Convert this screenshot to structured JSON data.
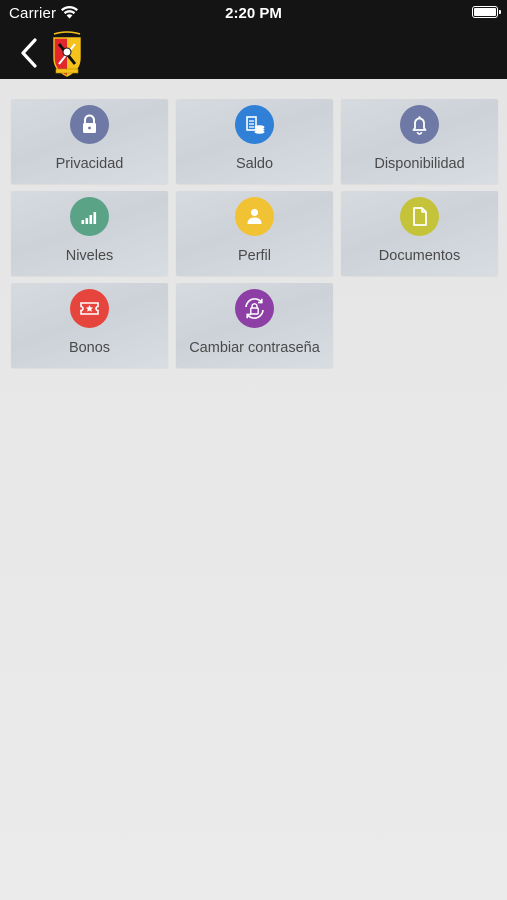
{
  "status_bar": {
    "carrier": "Carrier",
    "time": "2:20 PM"
  },
  "navbar": {
    "back_icon": "chevron-left-icon",
    "logo_icon": "club-crest-icon"
  },
  "menu": {
    "items": [
      {
        "label": "Privacidad",
        "icon": "lock-icon",
        "color": "#6f79a6"
      },
      {
        "label": "Saldo",
        "icon": "balance-icon",
        "color": "#2f80d6"
      },
      {
        "label": "Disponibilidad",
        "icon": "bell-icon",
        "color": "#6f79a6"
      },
      {
        "label": "Niveles",
        "icon": "signal-bars-icon",
        "color": "#5aa387"
      },
      {
        "label": "Perfil",
        "icon": "user-icon",
        "color": "#f1c233"
      },
      {
        "label": "Documentos",
        "icon": "document-icon",
        "color": "#c4c33a"
      },
      {
        "label": "Bonos",
        "icon": "ticket-icon",
        "color": "#e6453d"
      },
      {
        "label": "Cambiar contraseña",
        "icon": "refresh-lock-icon",
        "color": "#8e3fa5"
      }
    ]
  }
}
